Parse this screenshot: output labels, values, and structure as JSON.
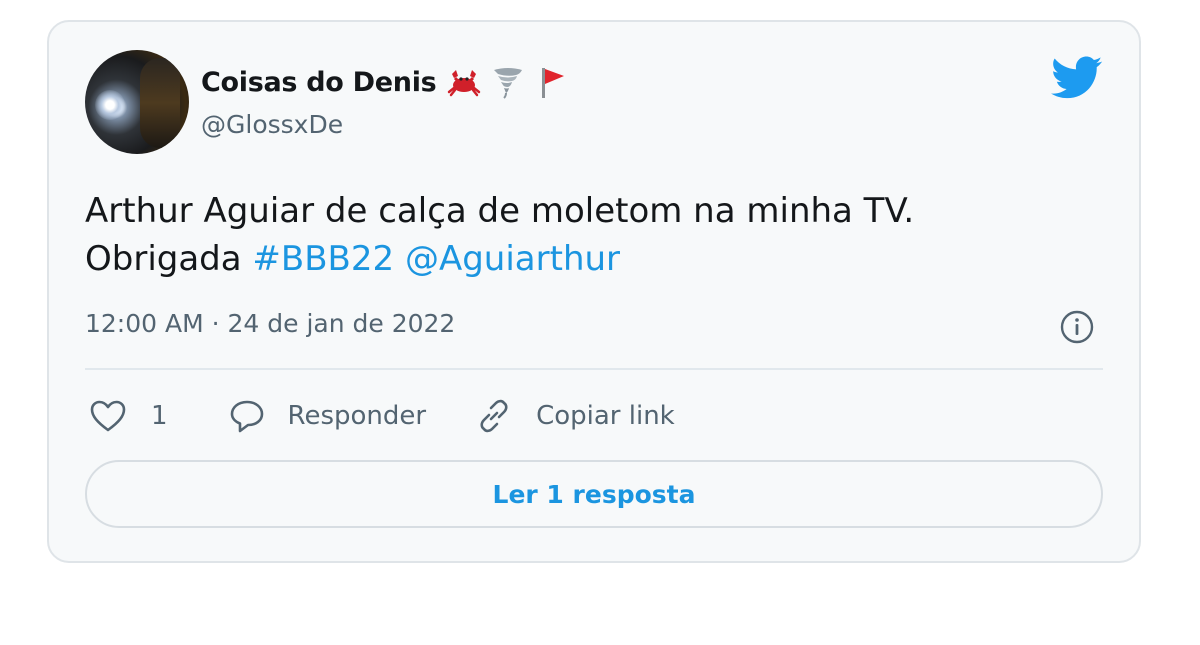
{
  "tweet": {
    "author_name": "Coisas do Denis",
    "author_handle": "@GlossxDe",
    "name_emojis": [
      "crab-icon",
      "tornado-icon",
      "red-flag-icon"
    ],
    "text_line1": "Arthur Aguiar de calça de moletom na minha TV.",
    "text_line2_plain": "Obrigada",
    "hashtag": "#BBB22",
    "mention": "@Aguiarthur",
    "timestamp": "12:00 AM · 24 de jan de 2022",
    "like_count": "1",
    "reply_label": "Responder",
    "copy_link_label": "Copiar link",
    "read_replies_label": "Ler 1 resposta"
  },
  "colors": {
    "brand_blue": "#1d9bf0",
    "link_blue": "#1b95e0",
    "text_primary": "#14171a",
    "text_secondary": "#536471",
    "card_bg": "#f7f9fa",
    "border": "#dfe4e8"
  }
}
